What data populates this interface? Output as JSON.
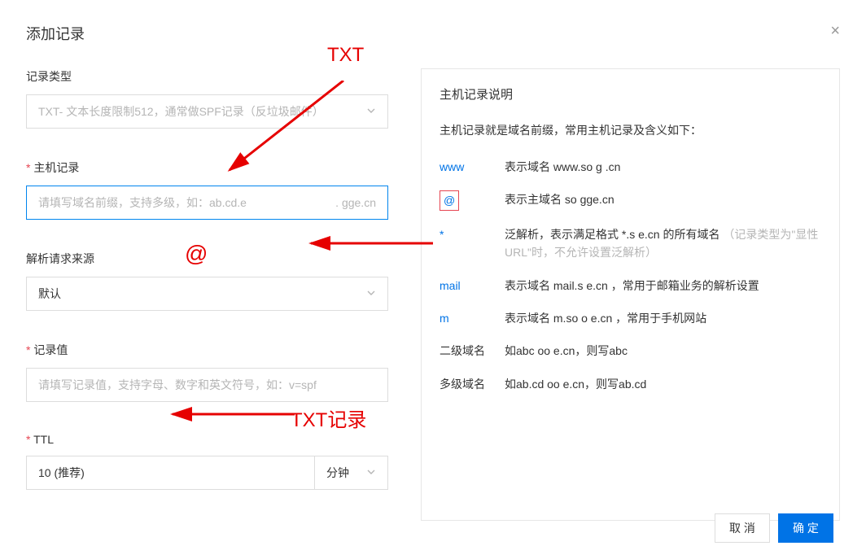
{
  "modal": {
    "title": "添加记录",
    "close_label": "×"
  },
  "form": {
    "record_type": {
      "label": "记录类型",
      "value": "TXT- 文本长度限制512，通常做SPF记录（反垃圾邮件）"
    },
    "host_record": {
      "label": "主机记录",
      "placeholder": "请填写域名前缀，支持多级，如：ab.cd.e",
      "suffix": ".              gge.cn"
    },
    "parse_source": {
      "label": "解析请求来源",
      "value": "默认"
    },
    "record_value": {
      "label": "记录值",
      "placeholder": "请填写记录值，支持字母、数字和英文符号，如：v=spf"
    },
    "ttl": {
      "label": "TTL",
      "value": "10 (推荐)",
      "unit": "分钟"
    }
  },
  "help_panel": {
    "title": "主机记录说明",
    "description": "主机记录就是域名前缀，常用主机记录及含义如下：",
    "rows": [
      {
        "key": "www",
        "key_blue": true,
        "val": "表示域名 www.so    g    .cn"
      },
      {
        "key": "@",
        "key_blue": true,
        "val": "表示主域名 so    gge.cn",
        "boxed": true
      },
      {
        "key": "*",
        "key_blue": true,
        "val": "泛解析，表示满足格式 *.s         e.cn 的所有域名",
        "note": "（记录类型为\"显性URL\"时，不允许设置泛解析）"
      },
      {
        "key": "mail",
        "key_blue": true,
        "val": "表示域名 mail.s          e.cn ，常用于邮箱业务的解析设置"
      },
      {
        "key": "m",
        "key_blue": true,
        "val": "表示域名 m.so   o    e.cn ，常用于手机网站"
      },
      {
        "key": "二级域名",
        "key_blue": false,
        "val": "如abc   oo    e.cn，则写abc"
      },
      {
        "key": "多级域名",
        "key_blue": false,
        "val": "如ab.cd   oo    e.cn，则写ab.cd"
      }
    ]
  },
  "annotations": {
    "txt": "TXT",
    "at": "@",
    "txtrec": "TXT记录"
  },
  "footer": {
    "cancel": "取 消",
    "confirm": "确 定"
  }
}
